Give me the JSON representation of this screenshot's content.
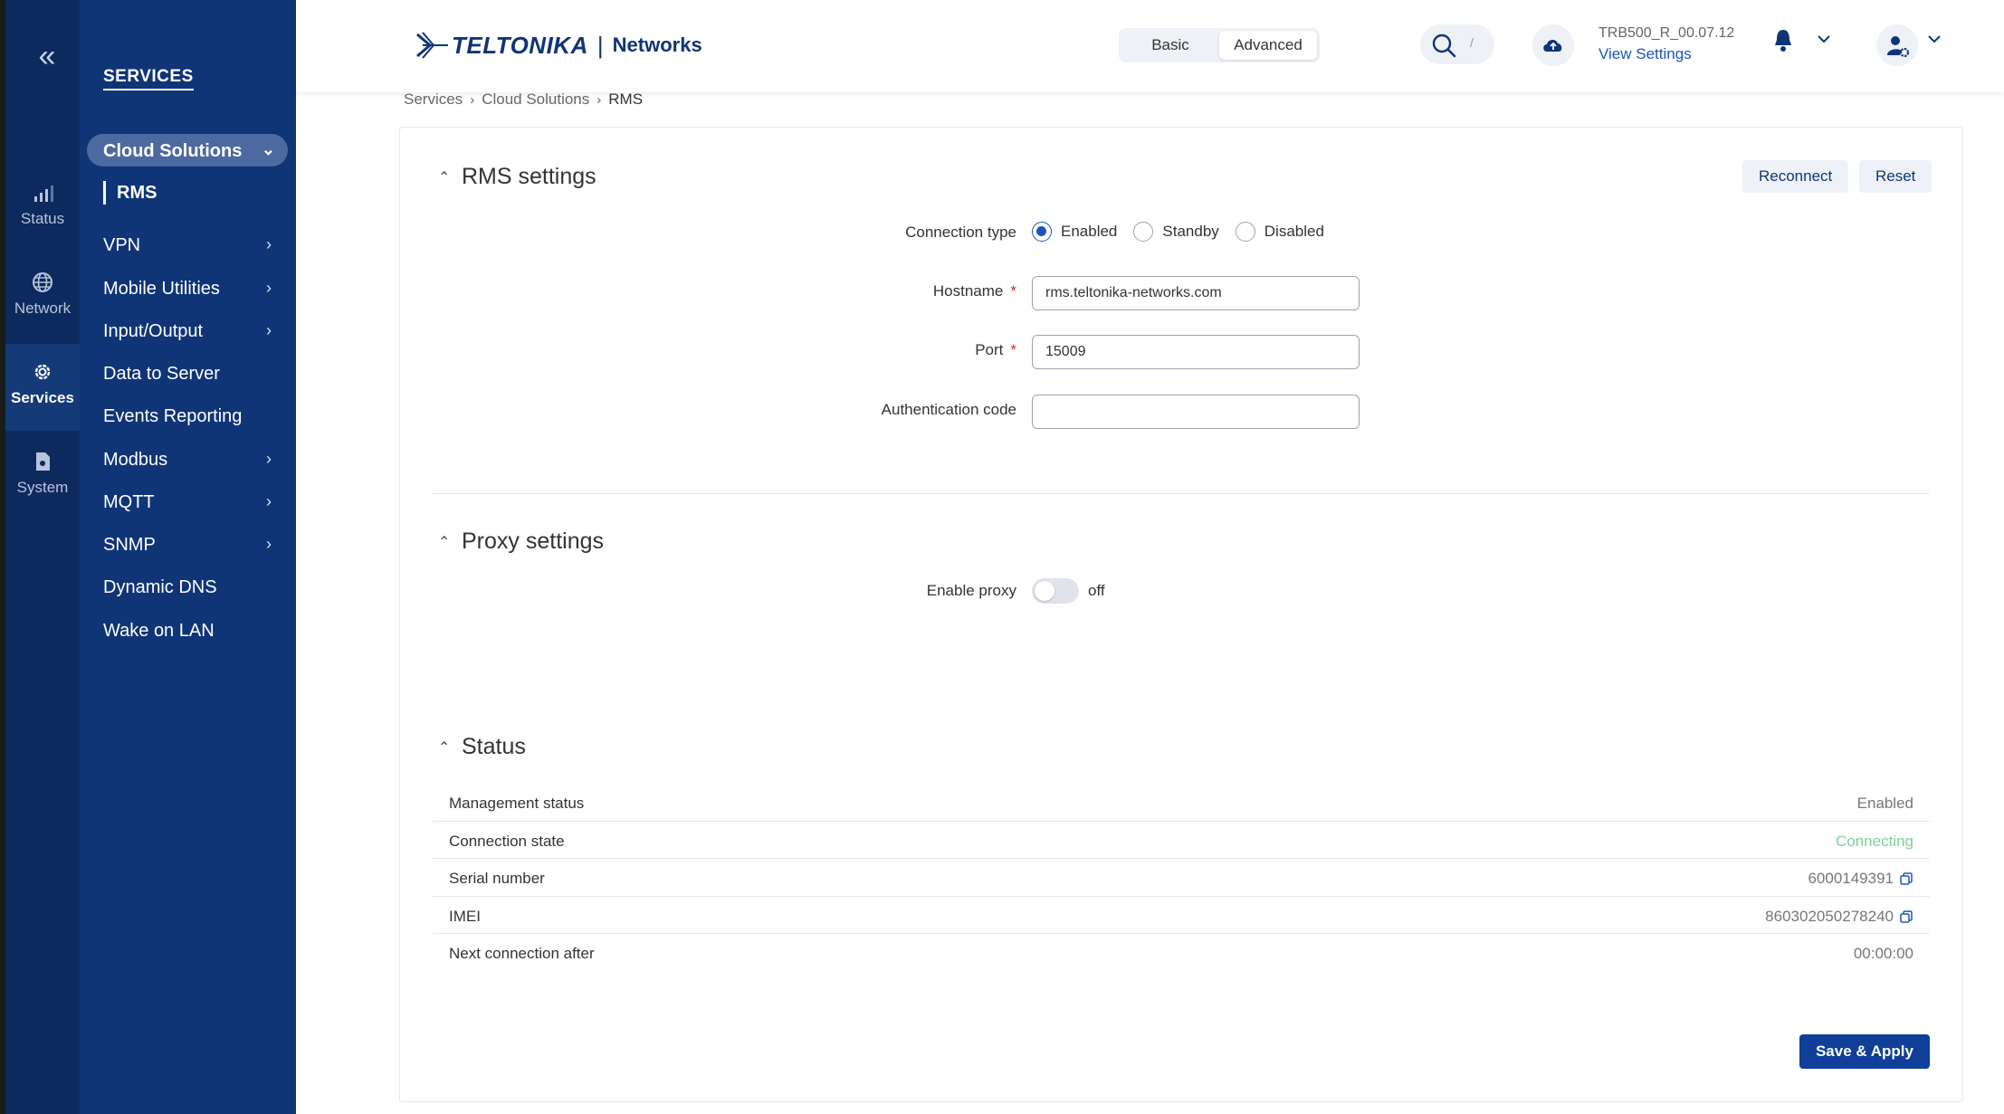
{
  "rail": {
    "items": [
      {
        "label": "Status",
        "icon": "signal-bars-icon"
      },
      {
        "label": "Network",
        "icon": "globe-icon"
      },
      {
        "label": "Services",
        "icon": "gear-icon"
      },
      {
        "label": "System",
        "icon": "file-icon"
      }
    ]
  },
  "submenu": {
    "title": "SERVICES",
    "group": "Cloud Solutions",
    "group_child": "RMS",
    "items": [
      {
        "label": "VPN"
      },
      {
        "label": "Mobile Utilities"
      },
      {
        "label": "Input/Output"
      },
      {
        "label": "Data to Server"
      },
      {
        "label": "Events Reporting"
      },
      {
        "label": "Modbus"
      },
      {
        "label": "MQTT"
      },
      {
        "label": "SNMP"
      },
      {
        "label": "Dynamic DNS"
      },
      {
        "label": "Wake on LAN"
      }
    ]
  },
  "header": {
    "brand": "TELTONIKA",
    "brand_suffix": "Networks",
    "mode_basic": "Basic",
    "mode_advanced": "Advanced",
    "search_shortcut": "/",
    "firmware": "TRB500_R_00.07.12",
    "view_settings": "View Settings"
  },
  "breadcrumb": {
    "items": [
      "Services",
      "Cloud Solutions",
      "RMS"
    ]
  },
  "rms": {
    "title": "RMS settings",
    "reconnect": "Reconnect",
    "reset": "Reset",
    "connection_type_label": "Connection type",
    "options": [
      "Enabled",
      "Standby",
      "Disabled"
    ],
    "selected_option": "Enabled",
    "hostname_label": "Hostname",
    "hostname_value": "rms.teltonika-networks.com",
    "port_label": "Port",
    "port_value": "15009",
    "auth_label": "Authentication code",
    "auth_value": ""
  },
  "proxy": {
    "title": "Proxy settings",
    "enable_label": "Enable proxy",
    "state": "off"
  },
  "status": {
    "title": "Status",
    "rows": [
      {
        "key": "Management status",
        "value": "Enabled"
      },
      {
        "key": "Connection state",
        "value": "Connecting"
      },
      {
        "key": "Serial number",
        "value": "6000149391"
      },
      {
        "key": "IMEI",
        "value": "860302050278240"
      },
      {
        "key": "Next connection after",
        "value": "00:00:00"
      }
    ]
  },
  "save_apply": "Save & Apply",
  "colors": {
    "rail": "#0d2a5e",
    "submenu": "#0f3577",
    "accent": "#1a56b8",
    "connecting": "#7fcf9a"
  }
}
